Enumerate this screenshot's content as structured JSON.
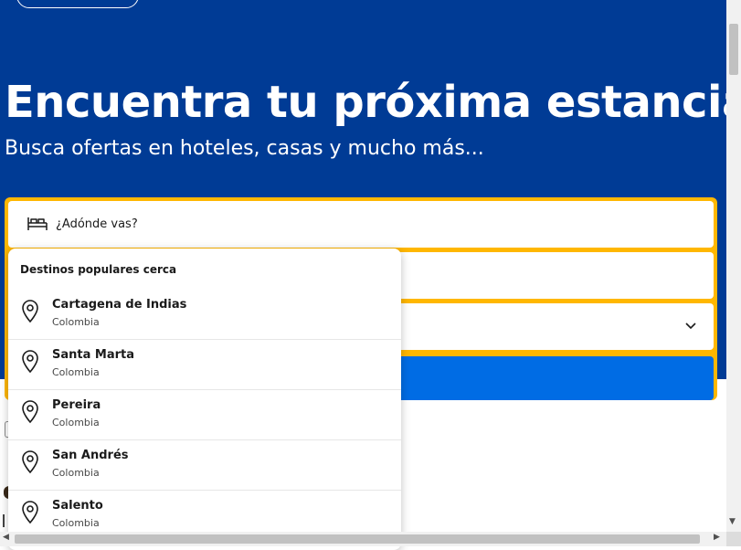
{
  "hero": {
    "title": "Encuentra tu próxima estancia",
    "subtitle": "Busca ofertas en hoteles, casas y mucho más..."
  },
  "search": {
    "destination_placeholder": "¿Adónde vas?",
    "bed_icon": "bed-icon",
    "chevron_icon": "chevron-down-icon"
  },
  "dropdown": {
    "heading": "Destinos populares cerca",
    "pin_icon": "map-pin-icon",
    "items": [
      {
        "city": "Cartagena de Indias",
        "country": "Colombia"
      },
      {
        "city": "Santa Marta",
        "country": "Colombia"
      },
      {
        "city": "Pereira",
        "country": "Colombia"
      },
      {
        "city": "San Andrés",
        "country": "Colombia"
      },
      {
        "city": "Salento",
        "country": "Colombia"
      }
    ]
  },
  "colors": {
    "hero_bg": "#003b95",
    "search_border": "#ffb700",
    "search_button": "#006ce4"
  },
  "scrollbar": {
    "arrow_down": "▼",
    "arrow_left": "◀",
    "arrow_right": "▶"
  }
}
